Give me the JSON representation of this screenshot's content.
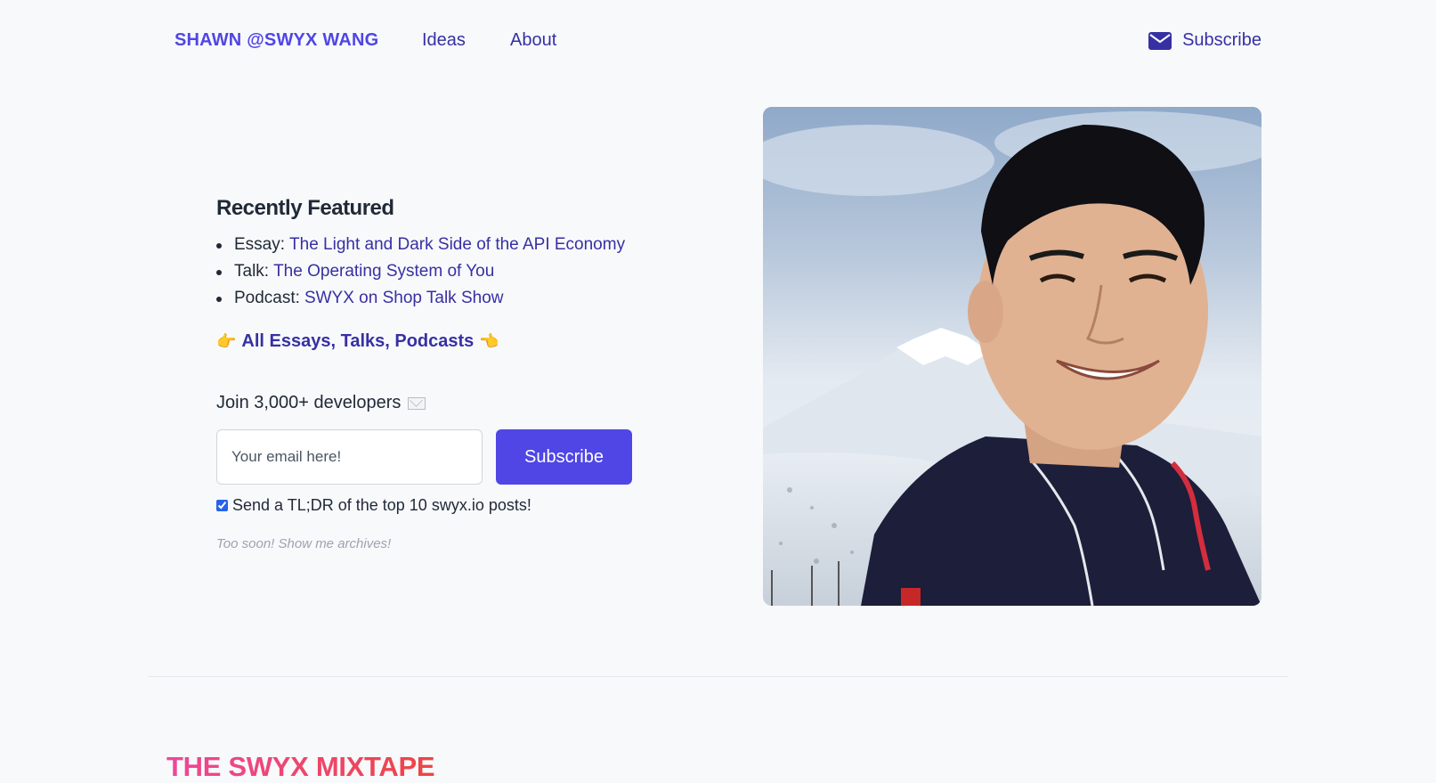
{
  "nav": {
    "brand": "SHAWN @SWYX WANG",
    "links": [
      "Ideas",
      "About"
    ],
    "subscribe_label": "Subscribe",
    "subscribe_icon": "mail-icon"
  },
  "featured": {
    "title": "Recently Featured",
    "items": [
      {
        "kind": "Essay:",
        "title": "The Light and Dark Side of the API Economy"
      },
      {
        "kind": "Talk:",
        "title": "The Operating System of You"
      },
      {
        "kind": "Podcast:",
        "title": "SWYX on Shop Talk Show"
      }
    ],
    "all_link": "All Essays, Talks, Podcasts",
    "emoji_left": "👉",
    "emoji_right": "👈"
  },
  "newsletter": {
    "join_text": "Join 3,000+ developers",
    "email_placeholder": "Your email here!",
    "subscribe_button": "Subscribe",
    "checkbox_label": "Send a TL;DR of the top 10 swyx.io posts!",
    "checkbox_checked": true,
    "archives_link": "Too soon! Show me archives!"
  },
  "photo": {
    "subject": "selfie-portrait-snow-mountain"
  },
  "mixtape": {
    "title": "THE SWYX MIXTAPE"
  },
  "colors": {
    "accent": "#4f46e5",
    "link": "#3730a3",
    "background": "#f8f9fb"
  }
}
